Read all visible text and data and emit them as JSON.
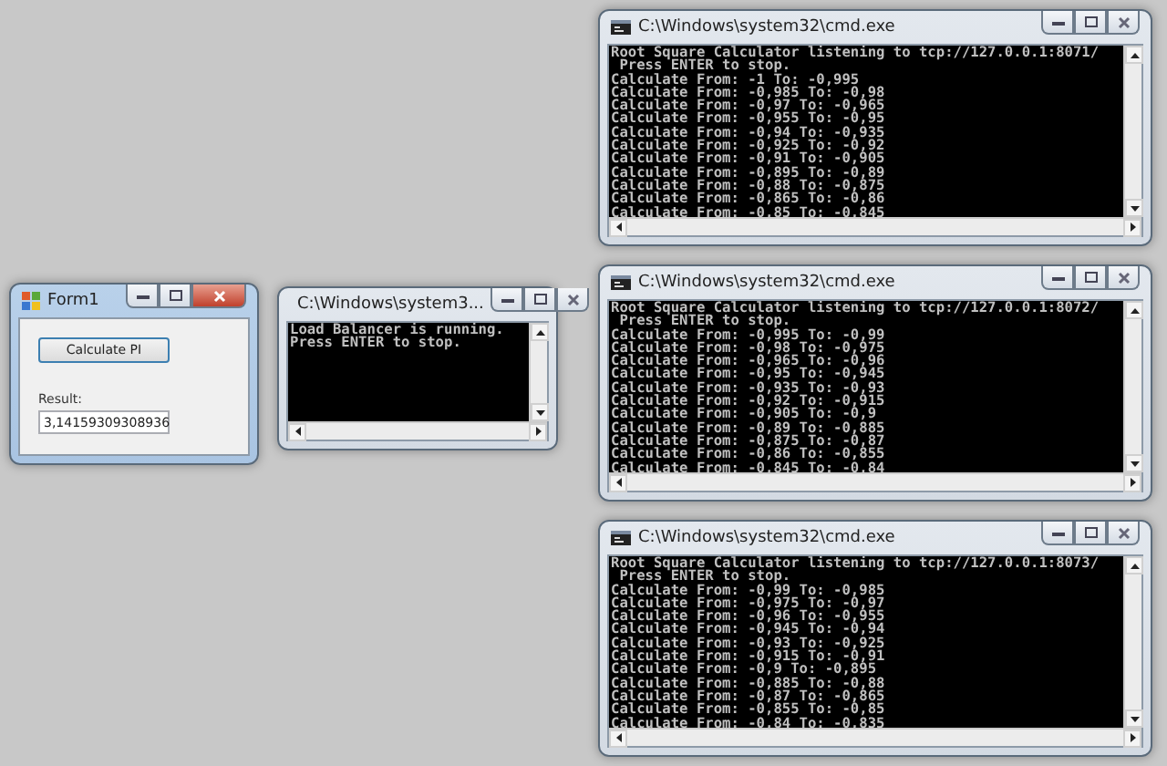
{
  "windows": [
    {
      "kind": "form",
      "title": "Form1",
      "active": true,
      "button": "Calculate PI",
      "result_label": "Result:",
      "result_value": "3,14159309308936"
    },
    {
      "kind": "console",
      "title": "C:\\Windows\\system3...",
      "active": false,
      "lines": [
        "Load Balancer is running.",
        "Press ENTER to stop."
      ]
    },
    {
      "kind": "console",
      "title": "C:\\Windows\\system32\\cmd.exe",
      "active": false,
      "lines": [
        "Root Square Calculator listening to tcp://127.0.0.1:8071/",
        " Press ENTER to stop.",
        "Calculate From: -1 To: -0,995",
        "Calculate From: -0,985 To: -0,98",
        "Calculate From: -0,97 To: -0,965",
        "Calculate From: -0,955 To: -0,95",
        "Calculate From: -0,94 To: -0,935",
        "Calculate From: -0,925 To: -0,92",
        "Calculate From: -0,91 To: -0,905",
        "Calculate From: -0,895 To: -0,89",
        "Calculate From: -0,88 To: -0,875",
        "Calculate From: -0,865 To: -0,86",
        "Calculate From: -0,85 To: -0,845"
      ]
    },
    {
      "kind": "console",
      "title": "C:\\Windows\\system32\\cmd.exe",
      "active": false,
      "lines": [
        "Root Square Calculator listening to tcp://127.0.0.1:8072/",
        " Press ENTER to stop.",
        "Calculate From: -0,995 To: -0,99",
        "Calculate From: -0,98 To: -0,975",
        "Calculate From: -0,965 To: -0,96",
        "Calculate From: -0,95 To: -0,945",
        "Calculate From: -0,935 To: -0,93",
        "Calculate From: -0,92 To: -0,915",
        "Calculate From: -0,905 To: -0,9",
        "Calculate From: -0,89 To: -0,885",
        "Calculate From: -0,875 To: -0,87",
        "Calculate From: -0,86 To: -0,855",
        "Calculate From: -0,845 To: -0,84"
      ]
    },
    {
      "kind": "console",
      "title": "C:\\Windows\\system32\\cmd.exe",
      "active": false,
      "lines": [
        "Root Square Calculator listening to tcp://127.0.0.1:8073/",
        " Press ENTER to stop.",
        "Calculate From: -0,99 To: -0,985",
        "Calculate From: -0,975 To: -0,97",
        "Calculate From: -0,96 To: -0,955",
        "Calculate From: -0,945 To: -0,94",
        "Calculate From: -0,93 To: -0,925",
        "Calculate From: -0,915 To: -0,91",
        "Calculate From: -0,9 To: -0,895",
        "Calculate From: -0,885 To: -0,88",
        "Calculate From: -0,87 To: -0,865",
        "Calculate From: -0,855 To: -0,85",
        "Calculate From: -0,84 To: -0,835"
      ]
    }
  ]
}
